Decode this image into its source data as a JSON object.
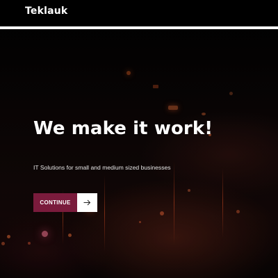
{
  "header": {
    "brand": "Teklauk"
  },
  "hero": {
    "headline": "We make it work!",
    "subheadline": "IT Solutions for small and medium sized businesses",
    "cta_label": "CONTINUE",
    "cta_icon": "arrow-right-icon"
  },
  "colors": {
    "background": "#000000",
    "accent": "#7a1b3c",
    "text": "#ffffff"
  }
}
